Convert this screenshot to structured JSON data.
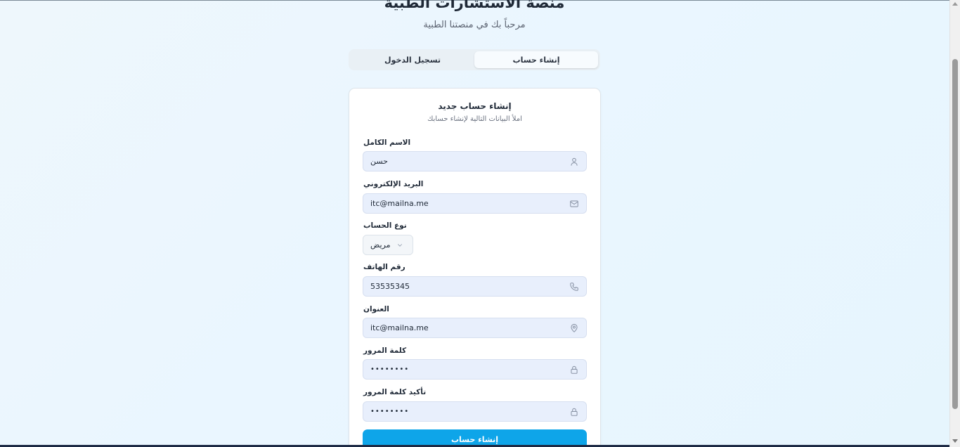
{
  "header": {
    "title": "منصة الاستشارات الطبية",
    "subtitle": "مرحباً بك في منصتنا الطبية"
  },
  "tabs": [
    {
      "label": "إنشاء حساب",
      "active": true
    },
    {
      "label": "تسجيل الدخول",
      "active": false
    }
  ],
  "form": {
    "title": "إنشاء حساب جديد",
    "subtitle": "املأ البيانات التالية لإنشاء حسابك",
    "full_name": {
      "label": "الاسم الكامل",
      "value": "حسن",
      "icon": "user-icon"
    },
    "email": {
      "label": "البريد الإلكتروني",
      "value": "itc@mailna.me",
      "icon": "mail-icon"
    },
    "account_type": {
      "label": "نوع الحساب",
      "value": "مريض",
      "icon": "chevron-down-icon"
    },
    "phone": {
      "label": "رقم الهاتف",
      "value": "53535345",
      "icon": "phone-icon"
    },
    "address": {
      "label": "العنوان",
      "value": "itc@mailna.me",
      "icon": "map-pin-icon"
    },
    "password": {
      "label": "كلمة المرور",
      "value": "••••••••",
      "icon": "lock-icon"
    },
    "confirm_password": {
      "label": "تأكيد كلمة المرور",
      "value": "••••••••",
      "icon": "lock-icon"
    },
    "submit_label": "إنشاء حساب"
  },
  "colors": {
    "primary": "#0ea5e9",
    "field_bg": "#e8effc",
    "page_bg": "#eaf6ff"
  }
}
